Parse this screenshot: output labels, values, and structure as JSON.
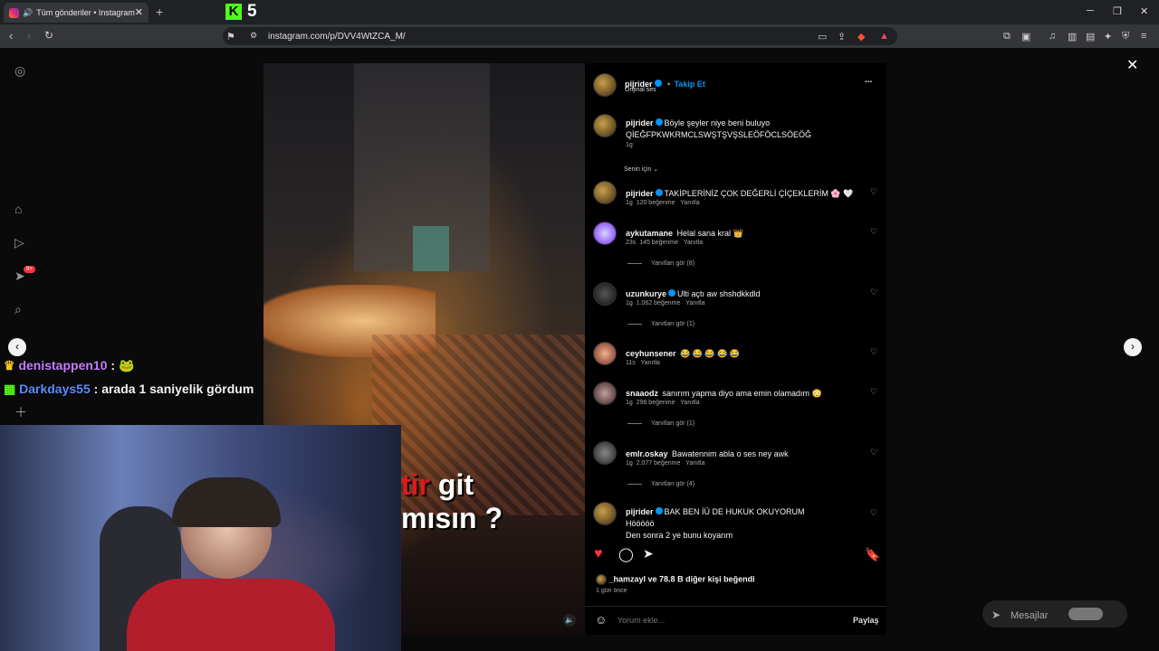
{
  "browser": {
    "tab_title": "Tüm gönderiler • Instagram",
    "new_tab": "+",
    "url": "instagram.com/p/DVV4WtZCA_M/",
    "overlay_counter": "5",
    "kick_letter": "K"
  },
  "post": {
    "author": "pijrider",
    "follow": "Takip Et",
    "audio": "Orijinal ses",
    "more": "...",
    "caption": "Böyle şeyler niye beni buluyo",
    "caption2": "QİEĞFPKWKRMCLSWŞTŞVŞSLEÖFÖCLSÖEÖĞ",
    "caption_time": "1g",
    "sort_label": "Senin için"
  },
  "comments": [
    {
      "user": "pijrider",
      "verified": true,
      "text": "TAKİPLERİNİZ ÇOK DEĞERLİ ÇİÇEKLERİM 🌸 🤍",
      "time": "1g",
      "likes": "120 beğenme",
      "reply": "Yanıtla"
    },
    {
      "user": "aykutamane",
      "verified": false,
      "text": "Helal sana kral 👑",
      "time": "23s",
      "likes": "145 beğenme",
      "reply": "Yanıtla",
      "view_replies": "Yanıtları gör (8)"
    },
    {
      "user": "uzunkurye",
      "verified": true,
      "text": "Ulti açtı aw shshdkkdld",
      "time": "1g",
      "likes": "1.062 beğenme",
      "reply": "Yanıtla",
      "view_replies": "Yanıtları gör (1)"
    },
    {
      "user": "ceyhunsener",
      "verified": false,
      "text": "😂 😂 😂 😂 😂",
      "time": "11s",
      "likes": "",
      "reply": "Yanıtla"
    },
    {
      "user": "snaaodz",
      "verified": false,
      "text": "sanırım yapma diyo ama emin olamadım 😳",
      "time": "1g",
      "likes": "296 beğenme",
      "reply": "Yanıtla",
      "view_replies": "Yanıtları gör (1)"
    },
    {
      "user": "emlr.oskay",
      "verified": false,
      "text": "Bawatennim abla o ses ney awk",
      "time": "1g",
      "likes": "2.077 beğenme",
      "reply": "Yanıtla",
      "view_replies": "Yanıtları gör (4)"
    },
    {
      "user": "pijrider",
      "verified": true,
      "text": "BAK BEN İÜ DE HUKUK OKUYORUM",
      "text2": "Hööööö",
      "text3": "Den sonra 2 ye bunu koyarım"
    }
  ],
  "actions": {
    "likes_line": "_hamzayl ve 78.8 B diğer kişi beğendi",
    "posted": "1 gün önce",
    "comment_placeholder": "Yorum ekle...",
    "share": "Paylaş"
  },
  "video_overlay": {
    "line1_red": "tir",
    "line1_white": "git",
    "line2": "mısın ?"
  },
  "stream_chat": [
    {
      "user": "denistappen10",
      "text": ":",
      "color": "#c77dff"
    },
    {
      "user": "Darkdays55",
      "text": ": arada 1 saniyelik gördum",
      "color": "#5b8cff"
    }
  ],
  "messages": {
    "label": "Mesajlar",
    "badge": "9+"
  },
  "colors": {
    "accent_blue": "#0095f6",
    "like_red": "#ff3040",
    "kick_green": "#53fc18"
  }
}
